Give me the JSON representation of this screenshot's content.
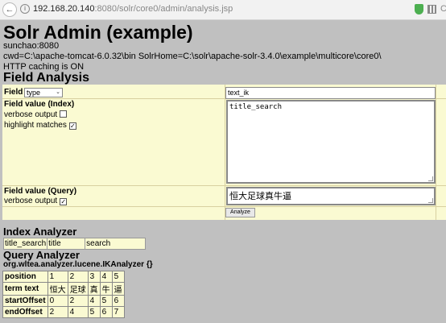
{
  "browser": {
    "url_host": "192.168.20.140",
    "url_rest": ":8080/solr/core0/admin/analysis.jsp",
    "truncated_icon_text": "C"
  },
  "page": {
    "title": "Solr Admin (example)",
    "host": "sunchao:8080",
    "cwd": "cwd=C:\\apache-tomcat-6.0.32\\bin SolrHome=C:\\solr\\apache-solr-3.4.0\\example\\multicore\\core0\\",
    "caching": "HTTP caching is ON",
    "section_title": "Field Analysis"
  },
  "form": {
    "field_label": "Field",
    "field_type_value": "type",
    "field_name_value": "text_ik",
    "index_label": "Field value (Index)",
    "index_verbose_label": "verbose output",
    "index_verbose_checked": false,
    "highlight_label": "highlight matches",
    "highlight_checked": true,
    "index_value": "title_search",
    "query_label": "Field value (Query)",
    "query_verbose_label": "verbose output",
    "query_verbose_checked": true,
    "query_value": "恒大足球真牛逼",
    "analyze_label": "Analyze"
  },
  "index_analyzer": {
    "title": "Index Analyzer",
    "tokens": [
      "title_search",
      "title",
      "search"
    ]
  },
  "query_analyzer": {
    "title": "Query Analyzer",
    "class_name": "org.wltea.analyzer.lucene.IKAnalyzer {}",
    "rows": [
      {
        "label": "position",
        "cells": [
          "1",
          "2",
          "3",
          "4",
          "5"
        ]
      },
      {
        "label": "term text",
        "cells": [
          "恒大",
          "足球",
          "真",
          "牛",
          "逼"
        ]
      },
      {
        "label": "startOffset",
        "cells": [
          "0",
          "2",
          "4",
          "5",
          "6"
        ]
      },
      {
        "label": "endOffset",
        "cells": [
          "2",
          "4",
          "5",
          "6",
          "7"
        ]
      }
    ]
  }
}
